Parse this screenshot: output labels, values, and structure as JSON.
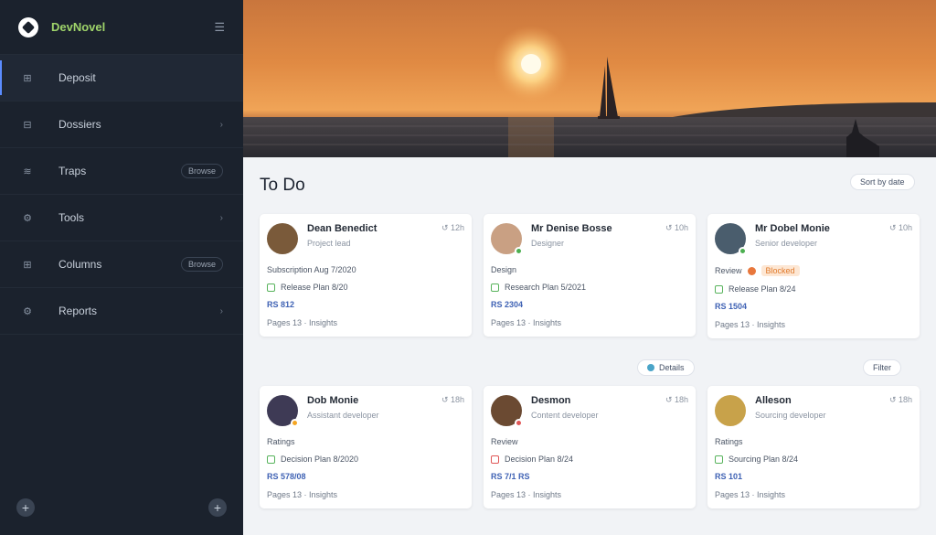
{
  "brand": {
    "name": "DevNovel"
  },
  "nav": [
    {
      "label": "Deposit",
      "icon": "grid-icon",
      "glyph": "⊞",
      "active": true
    },
    {
      "label": "Dossiers",
      "icon": "folder-icon",
      "glyph": "⊟",
      "chevron": "›"
    },
    {
      "label": "Traps",
      "icon": "tag-icon",
      "glyph": "≋",
      "badge": "Browse"
    },
    {
      "label": "Tools",
      "icon": "tool-icon",
      "glyph": "⚙",
      "chevron": "›"
    },
    {
      "label": "Columns",
      "icon": "columns-icon",
      "glyph": "⊞",
      "badge": "Browse"
    },
    {
      "label": "Reports",
      "icon": "report-icon",
      "glyph": "⚙",
      "chevron": "›"
    }
  ],
  "footer": {
    "left_glyph": "+",
    "right_glyph": "+"
  },
  "main": {
    "title": "To Do",
    "top_pill": "Sort by date",
    "mid_pill": "Details",
    "right_pill": "Filter"
  },
  "cards": [
    {
      "name": "Dean Benedict",
      "sub": "Project lead",
      "meta": "↺ 12h",
      "line1": "Subscription Aug 7/2020",
      "task": "Release Plan 8/20",
      "code": "RS 812",
      "foot": "Pages 13 · Insights",
      "avatar_bg": "#7a5a3a",
      "status": ""
    },
    {
      "name": "Mr Denise Bosse",
      "sub": "Designer",
      "meta": "↺ 10h",
      "line1": "Design",
      "task": "Research Plan 5/2021",
      "code": "RS 2304",
      "foot": "Pages 13 · Insights",
      "avatar_bg": "#c9a083",
      "status": "#4caf50"
    },
    {
      "name": "Mr Dobel Monie",
      "sub": "Senior developer",
      "meta": "↺ 10h",
      "line1": "Review",
      "chip": "Blocked",
      "task": "Release Plan 8/24",
      "code": "RS 1504",
      "foot": "Pages 13 · Insights",
      "avatar_bg": "#4a5d6d",
      "status": "#4caf50"
    },
    {
      "name": "Dob Monie",
      "sub": "Assistant developer",
      "meta": "↺ 18h",
      "line1": "Ratings",
      "task": "Decision Plan 8/2020",
      "code": "RS 578/08",
      "foot": "Pages 13 · Insights",
      "avatar_bg": "#3e3a55",
      "status": "#f5a623"
    },
    {
      "name": "Desmon",
      "sub": "Content developer",
      "meta": "↺ 18h",
      "line1": "Review",
      "task": "Decision Plan 8/24",
      "code": "RS 7/1 RS",
      "foot": "Pages 13 · Insights",
      "red": true,
      "avatar_bg": "#6b4a32",
      "status": "#e05656"
    },
    {
      "name": "Alleson",
      "sub": "Sourcing developer",
      "meta": "↺ 18h",
      "line1": "Ratings",
      "task": "Sourcing Plan 8/24",
      "code": "RS 101",
      "foot": "Pages 13 · Insights",
      "avatar_bg": "#c8a24a",
      "status": ""
    }
  ]
}
